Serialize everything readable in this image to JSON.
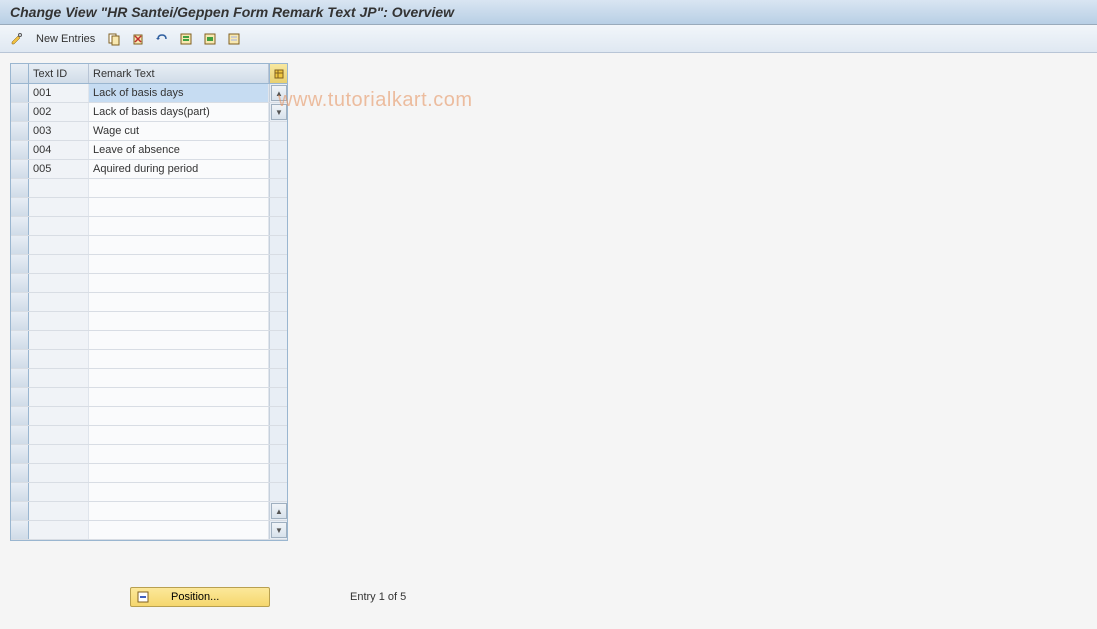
{
  "title": "Change View \"HR Santei/Geppen Form Remark Text JP\": Overview",
  "toolbar": {
    "new_entries_label": "New Entries"
  },
  "watermark": "www.tutorialkart.com",
  "table": {
    "headers": {
      "text_id": "Text ID",
      "remark_text": "Remark Text"
    },
    "rows": [
      {
        "id": "001",
        "text": "Lack of basis days",
        "selected": true
      },
      {
        "id": "002",
        "text": "Lack of basis days(part)",
        "selected": false
      },
      {
        "id": "003",
        "text": "Wage cut",
        "selected": false
      },
      {
        "id": "004",
        "text": "Leave of absence",
        "selected": false
      },
      {
        "id": "005",
        "text": "Aquired during period",
        "selected": false
      }
    ],
    "empty_rows": 19
  },
  "footer": {
    "position_label": "Position...",
    "entry_status": "Entry 1 of 5"
  }
}
